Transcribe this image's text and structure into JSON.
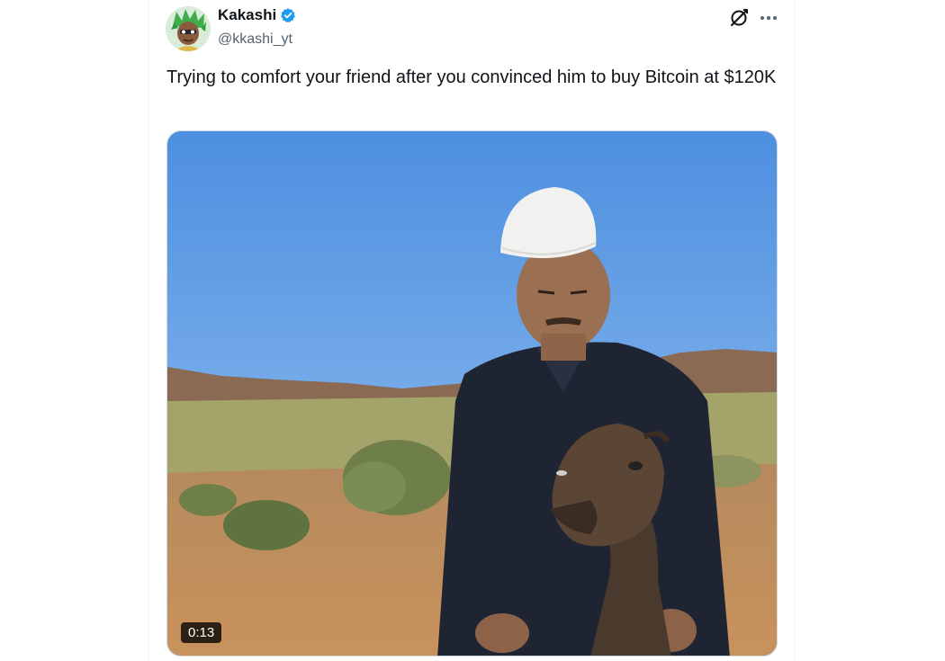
{
  "tweet": {
    "author": {
      "name": "Kakashi",
      "handle": "@kkashi_yt",
      "verified": true,
      "avatar_icon": "anime-avatar-icon"
    },
    "text": "Trying to comfort your friend after you convinced him to buy Bitcoin at $120K",
    "media": {
      "type": "video",
      "duration": "0:13"
    },
    "actions": {
      "grok_icon": "grok-icon",
      "more_icon": "more-dots-icon"
    }
  },
  "colors": {
    "verified": "#1d9bf0",
    "text_primary": "#0f1419",
    "text_secondary": "#536471",
    "border": "#eff3f4"
  }
}
